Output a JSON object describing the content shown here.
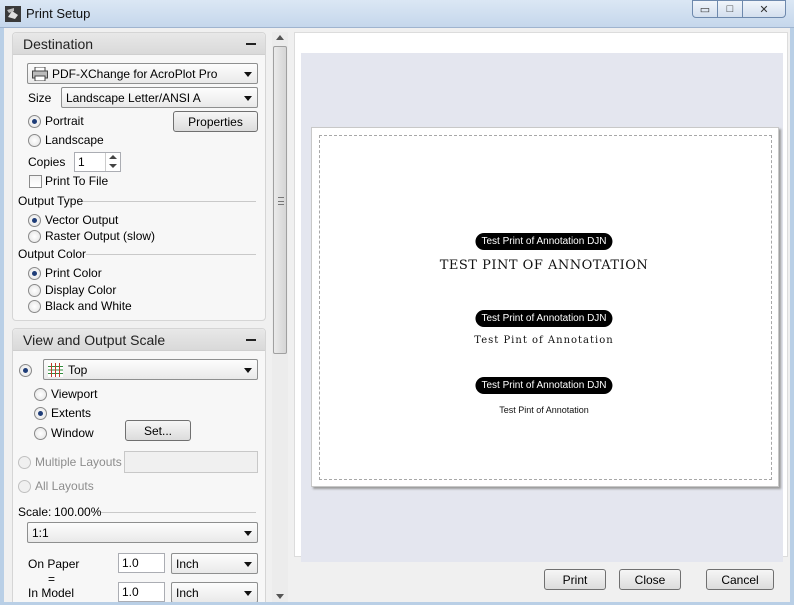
{
  "window": {
    "title": "Print Setup",
    "min_glyph": "▭",
    "max_glyph": "□",
    "close_glyph": "✕"
  },
  "destination": {
    "header": "Destination",
    "printer": "PDF-XChange for AcroPlot Pro",
    "size_label": "Size",
    "size_value": "Landscape Letter/ANSI A",
    "portrait": "Portrait",
    "landscape": "Landscape",
    "properties_button": "Properties",
    "copies_label": "Copies",
    "copies_value": "1",
    "print_to_file": "Print To File",
    "output_type_label": "Output Type",
    "vector_output": "Vector Output",
    "raster_output": "Raster Output (slow)",
    "output_color_label": "Output Color",
    "print_color": "Print Color",
    "display_color": "Display Color",
    "black_and_white": "Black and White"
  },
  "view": {
    "header": "View and Output Scale",
    "view_value": "Top",
    "viewport": "Viewport",
    "extents": "Extents",
    "window": "Window",
    "set_button": "Set...",
    "multiple_layouts": "Multiple Layouts",
    "all_layouts": "All Layouts",
    "scale_label": "Scale:",
    "scale_value": "100.00%",
    "ratio_value": "1:1",
    "on_paper_label": "On Paper",
    "equals": "=",
    "in_model_label": "In Model",
    "on_paper_value": "1.0",
    "in_model_value": "1.0",
    "unit_paper": "Inch",
    "unit_model": "Inch"
  },
  "preview": {
    "pill_1": "Test Print of Annotation DJN",
    "text_1": "TEST PINT OF ANNOTATION",
    "pill_2": "Test Print of Annotation DJN",
    "text_2": "Test Pint of Annotation",
    "pill_3": "Test Print of Annotation DJN",
    "text_3": "Test Pint of Annotation"
  },
  "buttons": {
    "print": "Print",
    "close": "Close",
    "cancel": "Cancel"
  },
  "colors": {
    "title_bar": "#c5d7ec",
    "pill": "#000000",
    "radio_dot": "#1f3d78"
  },
  "icons": {
    "app": "print-setup-icon",
    "printer": "printer-icon",
    "view": "grid-view-icon"
  }
}
